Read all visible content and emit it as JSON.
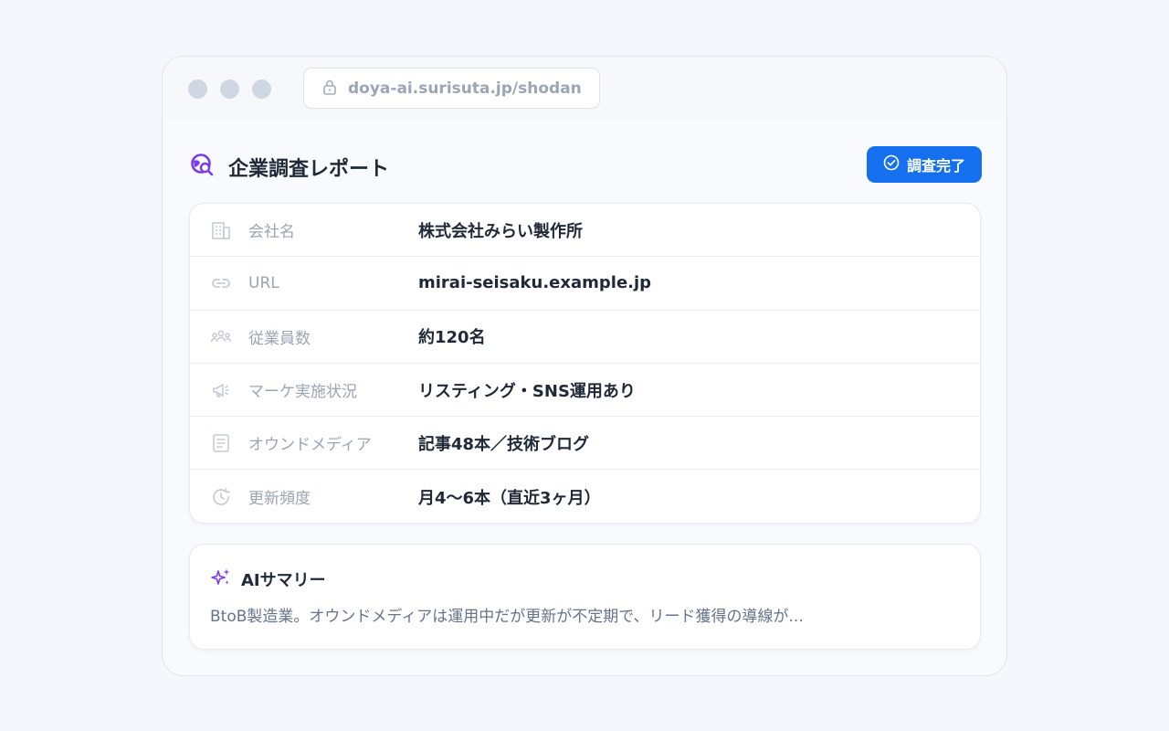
{
  "browser": {
    "url": "doya-ai.surisuta.jp/shodan"
  },
  "report": {
    "title": "企業調査レポート",
    "status_button": "調査完了",
    "rows": [
      {
        "icon": "building-icon",
        "label": "会社名",
        "value": "株式会社みらい製作所"
      },
      {
        "icon": "link-icon",
        "label": "URL",
        "value": "mirai-seisaku.example.jp"
      },
      {
        "icon": "users-icon",
        "label": "従業員数",
        "value": "約120名"
      },
      {
        "icon": "megaphone-icon",
        "label": "マーケ実施状況",
        "value": "リスティング・SNS運用あり"
      },
      {
        "icon": "document-icon",
        "label": "オウンドメディア",
        "value": "記事48本／技術ブログ"
      },
      {
        "icon": "refresh-clock-icon",
        "label": "更新頻度",
        "value": "月4〜6本（直近3ヶ月）"
      }
    ]
  },
  "summary": {
    "title": "AIサマリー",
    "text": "BtoB製造業。オウンドメディアは運用中だが更新が不定期で、リード獲得の導線が..."
  },
  "colors": {
    "accent": "#1570ef",
    "brand_purple": "#7c3aed",
    "muted_text": "#9aa5b4"
  }
}
